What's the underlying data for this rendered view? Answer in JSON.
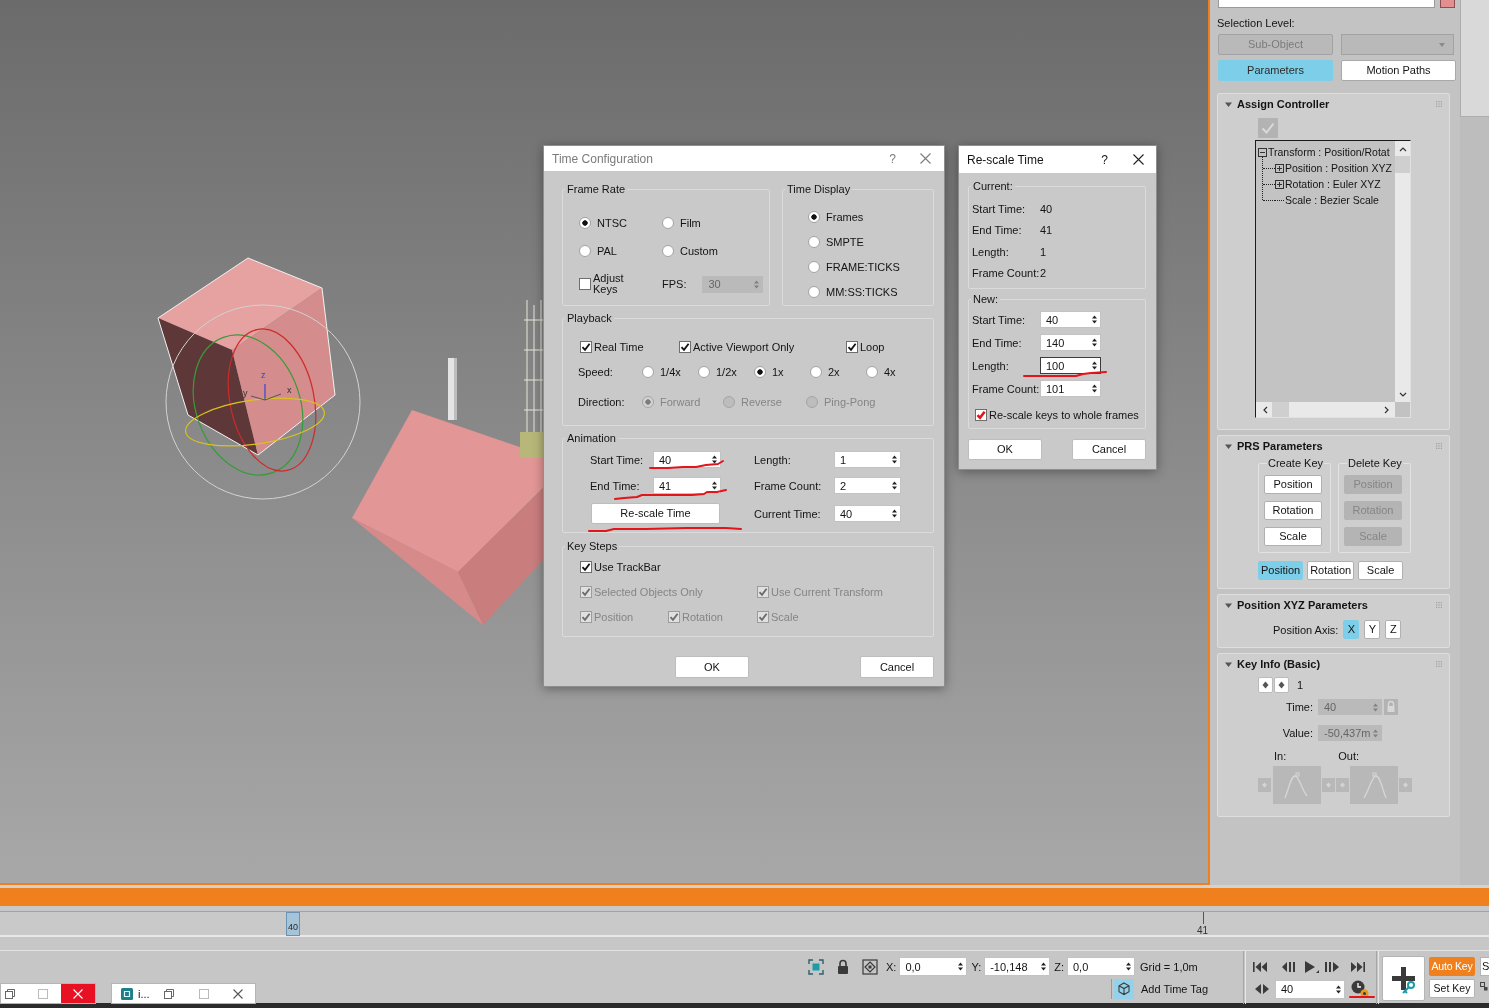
{
  "viewport": {
    "axis_labels": [
      "z",
      "y",
      "x"
    ]
  },
  "command_panel": {
    "selection_level": {
      "label": "Selection Level:",
      "sub_object": {
        "label": "Sub-Object",
        "disabled": true
      },
      "dropdown": {
        "disabled": true
      }
    },
    "modes": [
      {
        "label": "Parameters",
        "selected": true
      },
      {
        "label": "Motion Paths",
        "selected": false
      }
    ],
    "rollouts": [
      {
        "kind": "assign_controller",
        "title": "Assign Controller",
        "expanded": true,
        "tree": [
          {
            "label": "Transform : Position/Rotat",
            "expanded": true,
            "children": [
              {
                "label": "Position : Position XYZ",
                "expanded": false
              },
              {
                "label": "Rotation : Euler XYZ",
                "expanded": false
              },
              {
                "label": "Scale : Bezier Scale"
              }
            ]
          }
        ]
      },
      {
        "kind": "prs",
        "title": "PRS Parameters",
        "expanded": true,
        "create_key": {
          "title": "Create Key",
          "buttons": [
            {
              "label": "Position",
              "disabled": false
            },
            {
              "label": "Rotation",
              "disabled": false
            },
            {
              "label": "Scale",
              "disabled": false
            }
          ]
        },
        "delete_key": {
          "title": "Delete Key",
          "buttons": [
            {
              "label": "Position",
              "disabled": true
            },
            {
              "label": "Rotation",
              "disabled": true
            },
            {
              "label": "Scale",
              "disabled": true
            }
          ]
        },
        "tracks": [
          {
            "label": "Position",
            "selected": true
          },
          {
            "label": "Rotation",
            "selected": false
          },
          {
            "label": "Scale",
            "selected": false
          }
        ]
      },
      {
        "kind": "position_xyz",
        "title": "Position XYZ Parameters",
        "expanded": true,
        "axis_label": "Position Axis:",
        "axes": [
          {
            "label": "X",
            "selected": true
          },
          {
            "label": "Y",
            "selected": false
          },
          {
            "label": "Z",
            "selected": false
          }
        ]
      },
      {
        "kind": "key_info",
        "title": "Key Info (Basic)",
        "expanded": true,
        "key_number": "1",
        "fields": [
          {
            "label": "Time:",
            "value": "40",
            "disabled": true,
            "lock": true
          },
          {
            "label": "Value:",
            "value": "-50,437m",
            "disabled": true,
            "lock": false
          }
        ],
        "in_label": "In:",
        "out_label": "Out:"
      }
    ]
  },
  "time_configuration": {
    "title": "Time Configuration",
    "active": false,
    "help": "?",
    "frame_rate": {
      "title": "Frame Rate",
      "options": [
        {
          "label": "NTSC",
          "selected": true
        },
        {
          "label": "Film",
          "selected": false
        },
        {
          "label": "PAL",
          "selected": false
        },
        {
          "label": "Custom",
          "selected": false
        }
      ],
      "adjust_keys": {
        "label": "Adjust Keys",
        "checked": false
      },
      "fps": {
        "label": "FPS:",
        "value": "30",
        "disabled": true
      }
    },
    "time_display": {
      "title": "Time Display",
      "options": [
        {
          "label": "Frames",
          "selected": true
        },
        {
          "label": "SMPTE",
          "selected": false
        },
        {
          "label": "FRAME:TICKS",
          "selected": false
        },
        {
          "label": "MM:SS:TICKS",
          "selected": false
        }
      ]
    },
    "playback": {
      "title": "Playback",
      "checkboxes": [
        {
          "label": "Real Time",
          "checked": true
        },
        {
          "label": "Active Viewport Only",
          "checked": true
        },
        {
          "label": "Loop",
          "checked": true
        }
      ],
      "speed": {
        "label": "Speed:",
        "options": [
          {
            "label": "1/4x",
            "selected": false
          },
          {
            "label": "1/2x",
            "selected": false
          },
          {
            "label": "1x",
            "selected": true
          },
          {
            "label": "2x",
            "selected": false
          },
          {
            "label": "4x",
            "selected": false
          }
        ]
      },
      "direction": {
        "label": "Direction:",
        "options": [
          {
            "label": "Forward",
            "selected": true,
            "disabled": true
          },
          {
            "label": "Reverse",
            "selected": false,
            "disabled": true
          },
          {
            "label": "Ping-Pong",
            "selected": false,
            "disabled": true
          }
        ]
      }
    },
    "animation": {
      "title": "Animation",
      "left_fields": [
        {
          "label": "Start Time:",
          "value": "40"
        },
        {
          "label": "End Time:",
          "value": "41"
        }
      ],
      "rescale_button": "Re-scale Time",
      "right_fields": [
        {
          "label": "Length:",
          "value": "1"
        },
        {
          "label": "Frame Count:",
          "value": "2"
        },
        {
          "label": "Current Time:",
          "value": "40"
        }
      ]
    },
    "key_steps": {
      "title": "Key Steps",
      "checkboxes": [
        {
          "label": "Use TrackBar",
          "checked": true,
          "disabled": false
        },
        {
          "label": "Selected Objects Only",
          "checked": true,
          "disabled": true
        },
        {
          "label": "Use Current Transform",
          "checked": true,
          "disabled": true
        },
        {
          "label": "Position",
          "checked": true,
          "disabled": true
        },
        {
          "label": "Rotation",
          "checked": true,
          "disabled": true
        },
        {
          "label": "Scale",
          "checked": true,
          "disabled": true
        }
      ]
    },
    "buttons": [
      "OK",
      "Cancel"
    ]
  },
  "rescale_time": {
    "title": "Re-scale Time",
    "active": true,
    "help": "?",
    "current": {
      "title": "Current:",
      "rows": [
        {
          "label": "Start Time:",
          "value": "40"
        },
        {
          "label": "End Time:",
          "value": "41"
        },
        {
          "label": "Length:",
          "value": "1"
        },
        {
          "label": "Frame Count:",
          "value": "2"
        }
      ]
    },
    "new": {
      "title": "New:",
      "fields": [
        {
          "label": "Start Time:",
          "value": "40",
          "focused": false
        },
        {
          "label": "End Time:",
          "value": "140",
          "focused": false
        },
        {
          "label": "Length:",
          "value": "100",
          "focused": true
        },
        {
          "label": "Frame Count:",
          "value": "101",
          "focused": false
        }
      ]
    },
    "rescale_keys": {
      "label": "Re-scale keys to whole frames",
      "checked": true
    },
    "buttons": [
      "OK",
      "Cancel"
    ]
  },
  "time_slider": {
    "level": 1
  },
  "trackbar": {
    "time_marker": "40",
    "frame_labels": [
      "41"
    ]
  },
  "status_bar": {
    "coordinates": [
      {
        "label": "X:",
        "value": "0,0"
      },
      {
        "label": "Y:",
        "value": "-10,148"
      },
      {
        "label": "Z:",
        "value": "0,0"
      }
    ],
    "grid": "Grid = 1,0m",
    "add_time_tag": "Add Time Tag",
    "current_frame": "40",
    "auto_key": {
      "label": "Auto Key",
      "on": true
    },
    "set_key": "Set Key",
    "cut_off_field": "S"
  },
  "minimized_windows": [
    {
      "close_hovered": true
    },
    {
      "title": "i...",
      "close_hovered": false
    }
  ]
}
